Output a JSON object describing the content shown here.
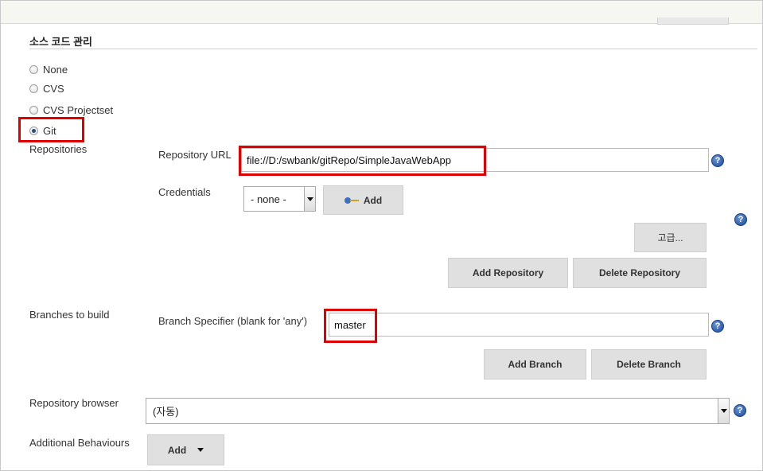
{
  "section": {
    "title": "소스 코드 관리"
  },
  "scm_options": [
    {
      "label": "None",
      "checked": false
    },
    {
      "label": "CVS",
      "checked": false
    },
    {
      "label": "CVS Projectset",
      "checked": false
    },
    {
      "label": "Git",
      "checked": true
    }
  ],
  "repositories": {
    "label": "Repositories",
    "url_label": "Repository URL",
    "url_value": "file://D:/swbank/gitRepo/SimpleJavaWebApp",
    "credentials_label": "Credentials",
    "credentials_value": "- none -",
    "add_button": "Add",
    "advanced_button": "고급...",
    "add_repository_button": "Add Repository",
    "delete_repository_button": "Delete Repository"
  },
  "branches": {
    "label": "Branches to build",
    "specifier_label": "Branch Specifier (blank for 'any')",
    "specifier_value": "master",
    "add_branch_button": "Add Branch",
    "delete_branch_button": "Delete Branch"
  },
  "repository_browser": {
    "label": "Repository browser",
    "value": "(자동)"
  },
  "additional_behaviours": {
    "label": "Additional Behaviours",
    "add_button": "Add"
  },
  "help_icon_glyph": "?",
  "colors": {
    "highlight": "#e00000",
    "button_bg": "#e0e0e0",
    "help_blue": "#2f5fae"
  }
}
